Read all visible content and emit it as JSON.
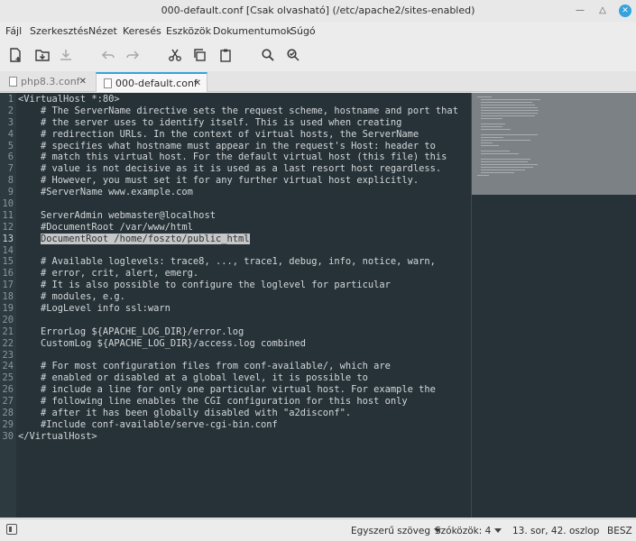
{
  "window": {
    "title": "000-default.conf [Csak olvasható] (/etc/apache2/sites-enabled)",
    "min_icon": "minimize-icon",
    "max_icon": "maximize-icon",
    "close_icon": "close-icon"
  },
  "menu": [
    "Fájl",
    "Szerkesztés",
    "Nézet",
    "Keresés",
    "Eszközök",
    "Dokumentumok",
    "Súgó"
  ],
  "toolbar_icons": [
    "new-document-icon",
    "open-folder-icon",
    "save-icon",
    "undo-icon",
    "redo-icon",
    "cut-icon",
    "copy-icon",
    "paste-icon",
    "search-icon",
    "search-replace-icon"
  ],
  "tabs": [
    {
      "label": "php8.3.conf",
      "active": false
    },
    {
      "label": "000-default.conf",
      "active": true
    }
  ],
  "editor": {
    "current_line": 13,
    "highlight_text": "DocumentRoot /home/foszto/public_html",
    "lines": [
      "<VirtualHost *:80>",
      "    # The ServerName directive sets the request scheme, hostname and port that",
      "    # the server uses to identify itself. This is used when creating",
      "    # redirection URLs. In the context of virtual hosts, the ServerName",
      "    # specifies what hostname must appear in the request's Host: header to",
      "    # match this virtual host. For the default virtual host (this file) this",
      "    # value is not decisive as it is used as a last resort host regardless.",
      "    # However, you must set it for any further virtual host explicitly.",
      "    #ServerName www.example.com",
      "",
      "    ServerAdmin webmaster@localhost",
      "    #DocumentRoot /var/www/html",
      "    DocumentRoot /home/foszto/public_html",
      "",
      "    # Available loglevels: trace8, ..., trace1, debug, info, notice, warn,",
      "    # error, crit, alert, emerg.",
      "    # It is also possible to configure the loglevel for particular",
      "    # modules, e.g.",
      "    #LogLevel info ssl:warn",
      "",
      "    ErrorLog ${APACHE_LOG_DIR}/error.log",
      "    CustomLog ${APACHE_LOG_DIR}/access.log combined",
      "",
      "    # For most configuration files from conf-available/, which are",
      "    # enabled or disabled at a global level, it is possible to",
      "    # include a line for only one particular virtual host. For example the",
      "    # following line enables the CGI configuration for this host only",
      "    # after it has been globally disabled with \"a2disconf\".",
      "    #Include conf-available/serve-cgi-bin.conf",
      "</VirtualHost>"
    ]
  },
  "statusbar": {
    "icon": "sidepanel-icon",
    "language": "Egyszerű szöveg",
    "spaces": "Szóközök: 4",
    "position": "13. sor, 42. oszlop",
    "mode": "BESZ"
  }
}
